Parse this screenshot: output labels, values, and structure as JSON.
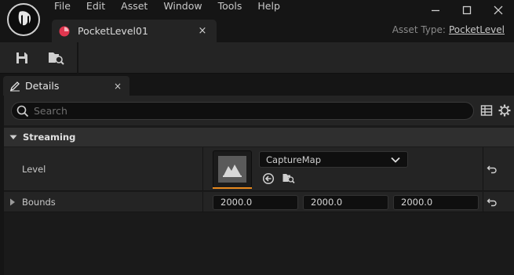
{
  "menu": [
    "File",
    "Edit",
    "Asset",
    "Window",
    "Tools",
    "Help"
  ],
  "document_tab": {
    "label": "PocketLevel01",
    "close": "×"
  },
  "asset_type": {
    "label": "Asset Type:",
    "value": "PocketLevel"
  },
  "details_tab": {
    "label": "Details",
    "close": "×"
  },
  "search": {
    "placeholder": "Search",
    "value": ""
  },
  "category": {
    "label": "Streaming"
  },
  "properties": {
    "level": {
      "label": "Level",
      "asset": "CaptureMap"
    },
    "bounds": {
      "label": "Bounds",
      "values": [
        "2000.0",
        "2000.0",
        "2000.0"
      ]
    }
  },
  "colors": {
    "accent": "#e8891e",
    "document_icon": "#e0364f",
    "background": "#151515",
    "panel": "#242424"
  },
  "icons": [
    "unreal-logo-icon",
    "minimize-icon",
    "maximize-icon",
    "close-icon",
    "level-asset-icon",
    "save-icon",
    "browse-icon",
    "details-pencil-icon",
    "search-icon",
    "table-view-icon",
    "settings-gear-icon",
    "collapse-arrow-icon",
    "expand-arrow-icon",
    "dropdown-chevron-icon",
    "use-selected-icon",
    "browse-folder-icon",
    "reset-to-default-icon"
  ]
}
